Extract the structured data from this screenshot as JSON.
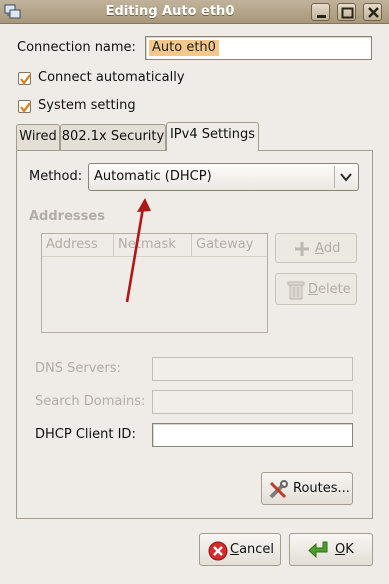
{
  "window": {
    "title": "Editing Auto eth0",
    "controls": [
      "minimize-icon",
      "maximize-icon",
      "close-icon"
    ]
  },
  "connection_name": {
    "label": "Connection name:",
    "value": "Auto eth0"
  },
  "options": {
    "connect_automatically": {
      "label": "Connect automatically",
      "checked": true
    },
    "system_setting": {
      "label": "System setting",
      "checked": true
    }
  },
  "tabs": [
    {
      "label": "Wired",
      "active": false
    },
    {
      "label": "802.1x Security",
      "active": false
    },
    {
      "label": "IPv4 Settings",
      "active": true
    }
  ],
  "ipv4": {
    "method_label": "Method:",
    "method_value": "Automatic (DHCP)",
    "addresses_heading": "Addresses",
    "columns": [
      "Address",
      "Netmask",
      "Gateway"
    ],
    "add_button": "Add",
    "delete_button": "Delete",
    "dns_label": "DNS Servers:",
    "search_label": "Search Domains:",
    "dhcp_label": "DHCP Client ID:",
    "dns_value": "",
    "search_value": "",
    "dhcp_value": "",
    "routes_button": "Routes..."
  },
  "footer": {
    "cancel_button": "Cancel",
    "ok_button": "OK"
  },
  "colors": {
    "titlebar": "#a89879",
    "selection": "#f4c78a",
    "checkmark": "#e07b1a",
    "annotation_arrow": "#b01818",
    "ok_icon": "#4aa12a",
    "cancel_icon": "#d42c2c"
  },
  "icons": {
    "window_icon": "network-connection-icon",
    "add": "plus-icon",
    "delete": "trash-icon",
    "routes": "tools-icon",
    "cancel": "cancel-icon",
    "ok": "ok-arrow-icon",
    "combo": "chevron-down-icon"
  }
}
